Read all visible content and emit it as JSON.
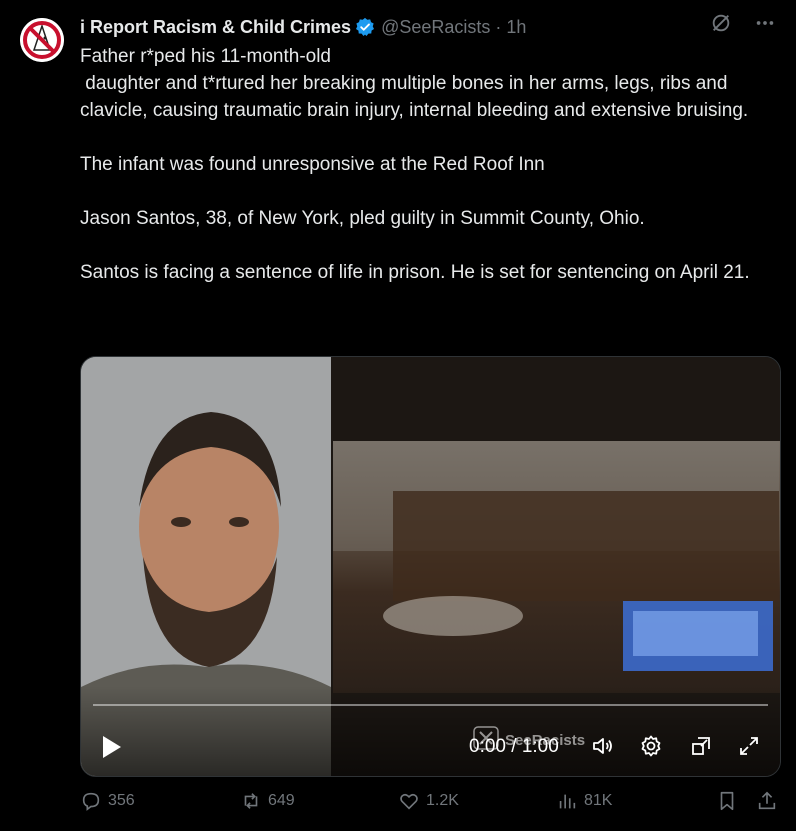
{
  "tweet": {
    "author_name": "i Report Racism & Child Crimes",
    "handle": "@SeeRacists",
    "separator": "·",
    "time": "1h",
    "text": "Father r*ped his 11-month-old\n daughter and t*rtured her breaking multiple bones in her arms, legs, ribs and clavicle, causing traumatic brain injury, internal bleeding and extensive bruising.\n\nThe infant was found unresponsive at the Red Roof Inn\n\nJason Santos, 38, of New York, pled guilty in Summit County, Ohio.\n\nSantos is facing a sentence of life in prison. He is set for sentencing on April 21."
  },
  "video": {
    "time_readout": "0:00 / 1:00",
    "watermark": "SeeRacists",
    "progress_fraction": 0
  },
  "actions": {
    "replies": "356",
    "reposts": "649",
    "likes": "1.2K",
    "views": "81K"
  },
  "colors": {
    "background": "#000000",
    "text": "#e7e9ea",
    "secondary": "#71767b",
    "verified": "#1d9bf0",
    "avatar_red": "#c8102e"
  },
  "icons": [
    "verified-badge-icon",
    "grok-icon",
    "more-icon",
    "play-icon",
    "x-logo-icon",
    "volume-icon",
    "settings-icon",
    "pip-icon",
    "fullscreen-icon",
    "reply-icon",
    "repost-icon",
    "like-icon",
    "views-icon",
    "bookmark-icon",
    "share-icon"
  ]
}
